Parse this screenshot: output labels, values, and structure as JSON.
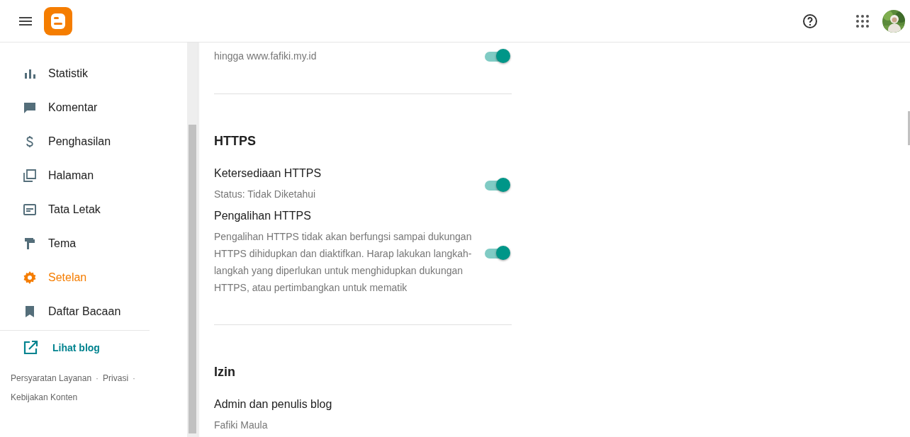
{
  "sidebar": {
    "items": [
      {
        "label": "Statistik",
        "selected": false
      },
      {
        "label": "Komentar",
        "selected": false
      },
      {
        "label": "Penghasilan",
        "selected": false
      },
      {
        "label": "Halaman",
        "selected": false
      },
      {
        "label": "Tata Letak",
        "selected": false
      },
      {
        "label": "Tema",
        "selected": false
      },
      {
        "label": "Setelan",
        "selected": true
      },
      {
        "label": "Daftar Bacaan",
        "selected": false
      }
    ],
    "view_blog": "Lihat blog",
    "footer_links": [
      "Persyaratan Layanan",
      "Privasi",
      "Kebijakan Konten"
    ],
    "footer_separators": [
      "·",
      "·"
    ]
  },
  "sections": [
    {
      "settings": [
        {
          "description": "hingga www.fafiki.my.id",
          "on": true
        }
      ]
    },
    {
      "title": "HTTPS",
      "settings": [
        {
          "label": "Ketersediaan HTTPS",
          "description": "Status: Tidak Diketahui",
          "on": true
        },
        {
          "label": "Pengalihan HTTPS",
          "description": "Pengalihan HTTPS tidak akan berfungsi sampai dukungan HTTPS dihidupkan dan diaktifkan. Harap lakukan langkah-langkah yang diperlukan untuk menghidupkan dukungan HTTPS, atau pertimbangkan untuk mematik",
          "on": true
        }
      ]
    },
    {
      "title": "Izin",
      "settings": [
        {
          "label": "Admin dan penulis blog",
          "description": "Fafiki Maula"
        }
      ]
    }
  ]
}
